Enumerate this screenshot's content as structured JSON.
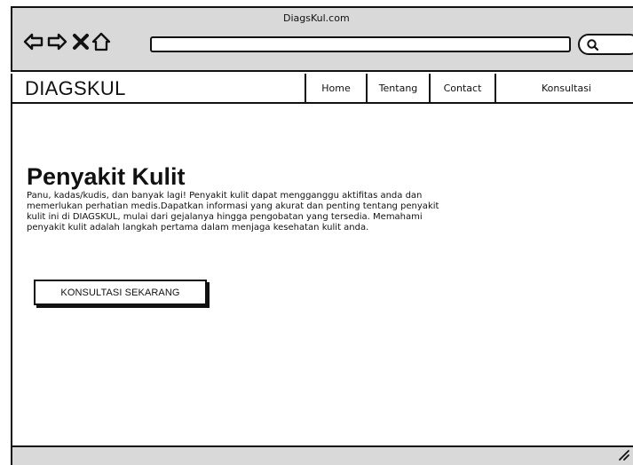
{
  "browser": {
    "title": "DiagsKul.com",
    "address_value": "",
    "search_value": "",
    "icons": {
      "back": "back-arrow-icon",
      "forward": "forward-arrow-icon",
      "stop": "close-icon",
      "home": "home-icon",
      "search": "search-icon"
    }
  },
  "header": {
    "brand": "DIAGSKUL",
    "nav_items": [
      {
        "label": "Home"
      },
      {
        "label": "Tentang"
      },
      {
        "label": "Contact"
      },
      {
        "label": "Konsultasi"
      }
    ]
  },
  "main": {
    "title": "Penyakit Kulit",
    "description": "Panu, kadas/kudis, dan banyak lagi! Penyakit kulit dapat mengganggu aktifitas anda dan memerlukan perhatian medis.Dapatkan informasi yang akurat dan penting tentang penyakit kulit ini di DIAGSKUL, mulai dari gejalanya hingga pengobatan yang tersedia. Memahami penyakit kulit adalah langkah pertama dalam menjaga kesehatan kulit anda.",
    "cta_label": "KONSULTASI SEKARANG"
  },
  "colors": {
    "chrome": "#d9d9d9",
    "outline": "#111111",
    "background": "#ffffff"
  }
}
